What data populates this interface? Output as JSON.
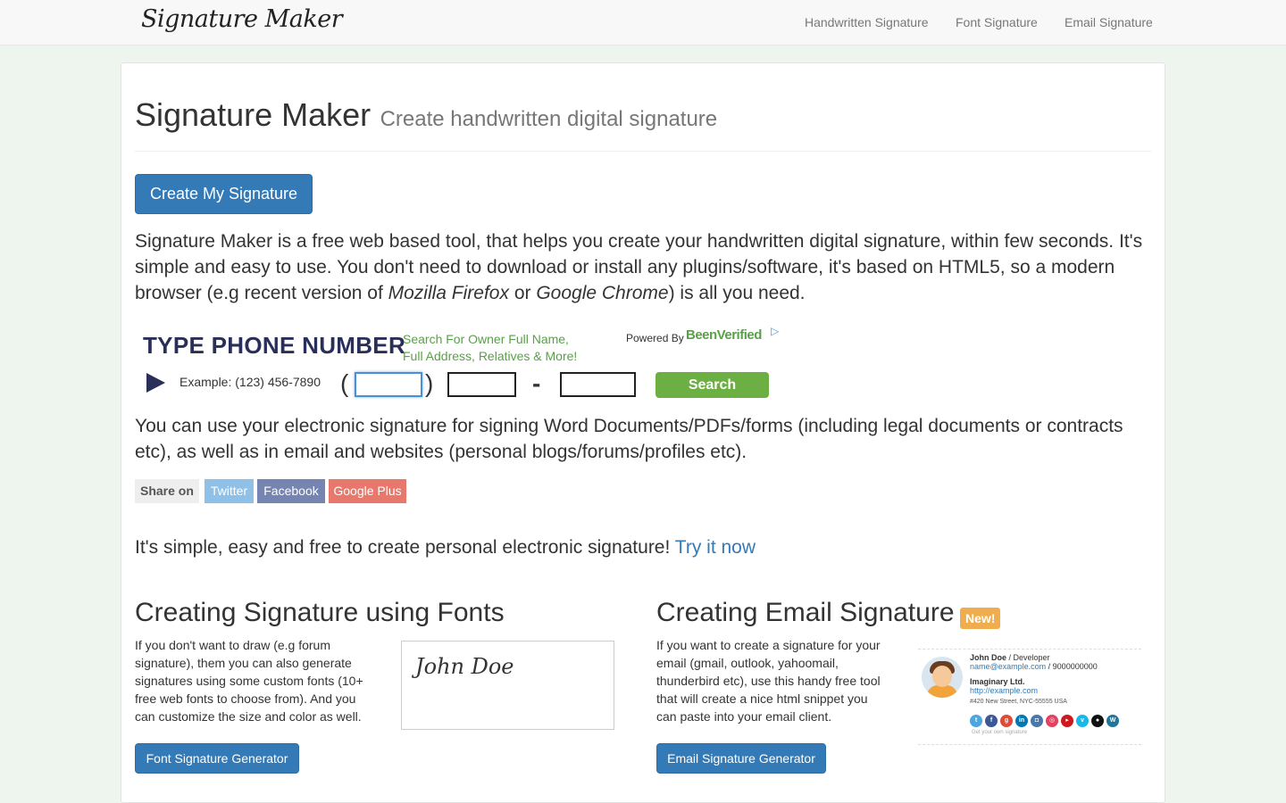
{
  "navbar": {
    "brand": "Signature Maker",
    "links": [
      "Handwritten Signature",
      "Font Signature",
      "Email Signature"
    ]
  },
  "header": {
    "title": "Signature Maker",
    "subtitle": "Create handwritten digital signature"
  },
  "create_button": "Create My Signature",
  "intro": {
    "part1": "Signature Maker is a free web based tool, that helps you create your handwritten digital signature, within few seconds. It's simple and easy to use. You don't need to download or install any plugins/software, it's based on HTML5, so a modern browser (e.g recent version of ",
    "firefox": "Mozilla Firefox",
    "or": " or ",
    "chrome": "Google Chrome",
    "part2": ") is all you need."
  },
  "ad": {
    "title": "TYPE PHONE NUMBER",
    "subtitle_line1": "Search For Owner Full Name,",
    "subtitle_line2": "Full Address, Relatives & More!",
    "powered_by": "Powered By",
    "brand": "BeenVerified",
    "example": "Example: (123) 456-7890",
    "open_paren": "(",
    "close_paren": ")",
    "dash": "-",
    "search_label": "Search"
  },
  "usage_text": "You can use your electronic signature for signing Word Documents/PDFs/forms (including legal documents or contracts etc), as well as in email and websites (personal blogs/forums/profiles etc).",
  "share": {
    "label": "Share on",
    "twitter": "Twitter",
    "facebook": "Facebook",
    "google_plus": "Google Plus",
    "colors": {
      "twitter": "#8fc1e8",
      "facebook": "#7584b0",
      "google_plus": "#e8786c"
    }
  },
  "try": {
    "text": "It's simple, easy and free to create personal electronic signature! ",
    "link": "Try it now"
  },
  "fonts_section": {
    "heading": "Creating Signature using Fonts",
    "line1": "If you don't want to draw (e.g forum",
    "line2": "signature), them you can also generate",
    "line3": "signatures using some custom fonts (10+",
    "line4": "free web fonts to choose from). And you",
    "line5": "can customize the size and color as well.",
    "preview_text": "John Doe",
    "button": "Font Signature Generator"
  },
  "email_section": {
    "heading": "Creating Email Signature",
    "badge": "New!",
    "line1": "If you want to create a signature for your",
    "line2": "email (gmail, outlook, yahoomail,",
    "line3": "thunderbird etc), use this handy free tool",
    "line4": "that will create a nice html snippet you",
    "line5": "can paste into your email client.",
    "button": "Email Signature Generator",
    "preview": {
      "name": "John Doe",
      "role": " / Developer",
      "email": "name@example.com",
      "phone": " / 9000000000",
      "company": "Imaginary Ltd.",
      "website": "http://example.com",
      "address": "#420 New Street, NYC-55555 USA",
      "footer": "Get your own signature"
    }
  }
}
